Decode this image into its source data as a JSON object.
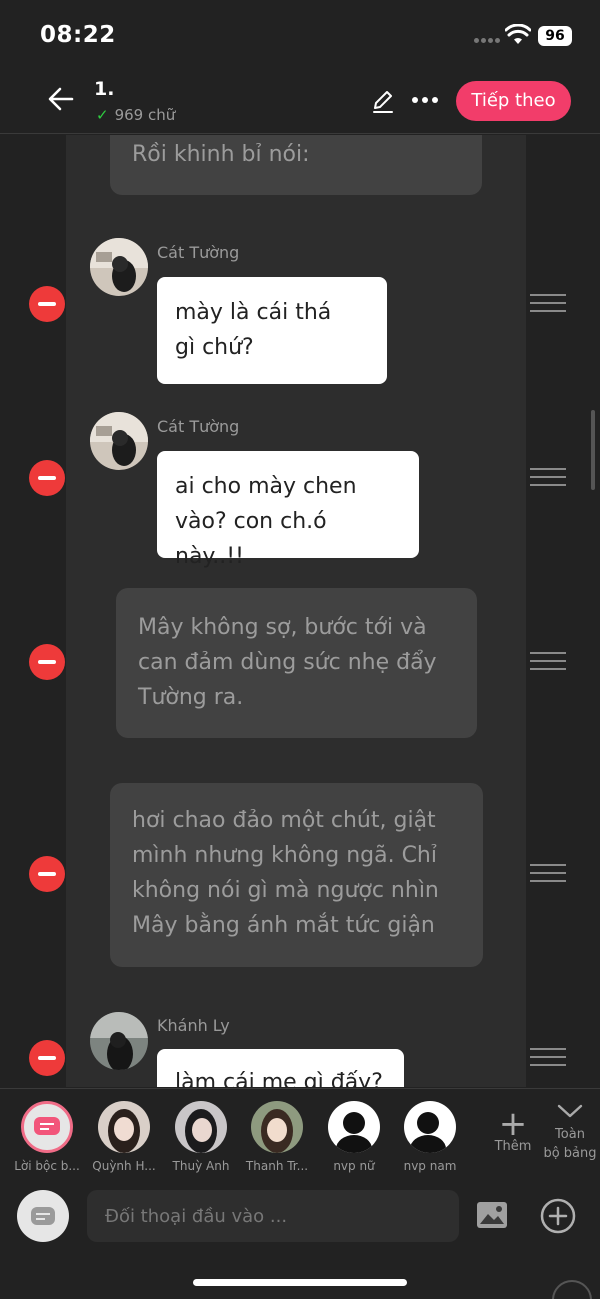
{
  "status": {
    "time": "08:22",
    "battery": "96"
  },
  "header": {
    "title": "1.",
    "word_count": "969 chữ",
    "next_label": "Tiếp theo"
  },
  "messages": [
    {
      "type": "narration",
      "text": "Rồi khinh bỉ nói:"
    },
    {
      "type": "character",
      "name": "Cát Tường",
      "lines": [
        "mày là cái thá",
        "gì chứ?"
      ]
    },
    {
      "type": "character",
      "name": "Cát Tường",
      "lines": [
        "ai cho mày chen",
        "vào? con ch.ó này..!!"
      ]
    },
    {
      "type": "narration",
      "lines": [
        "Mây không sợ, bước tới và",
        "can đảm dùng sức nhẹ đẩy",
        "Tường ra."
      ]
    },
    {
      "type": "narration",
      "lines": [
        "hơi chao đảo một chút, giật",
        "mình nhưng không ngã. Chỉ",
        "không nói gì mà ngược nhìn",
        "Mây bằng ánh mắt tức giận"
      ]
    },
    {
      "type": "character",
      "name": "Khánh Ly",
      "lines": [
        "làm cái mẹ gì đấy?"
      ]
    }
  ],
  "characters": [
    {
      "label": "Lời bộc b..."
    },
    {
      "label": "Quỳnh H..."
    },
    {
      "label": "Thuỳ Anh"
    },
    {
      "label": "Thanh Tr..."
    },
    {
      "label": "nvp nữ"
    },
    {
      "label": "nvp nam"
    }
  ],
  "char_actions": {
    "add_label": "Thêm",
    "all_line1": "Toàn",
    "all_line2": "bộ bảng"
  },
  "input": {
    "placeholder": "Đối thoại đầu vào ..."
  },
  "colors": {
    "accent": "#f23d6a",
    "delete": "#ee3a3a",
    "narration_bg": "#424242",
    "bubble_bg": "#ffffff"
  },
  "icons": [
    "back-arrow-icon",
    "check-icon",
    "pencil-icon",
    "more-icon",
    "minus-icon",
    "drag-handle-icon",
    "plus-icon",
    "chevron-down-icon",
    "image-icon",
    "add-circle-icon",
    "chat-icon"
  ]
}
